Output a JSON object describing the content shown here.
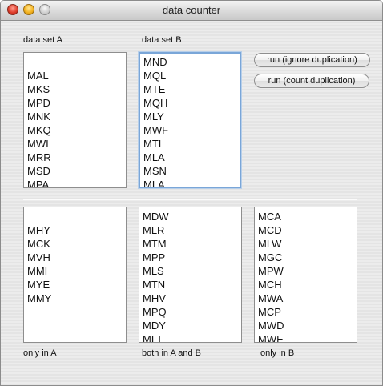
{
  "window": {
    "title": "data counter"
  },
  "inputs": {
    "set_a": {
      "label": "data set A",
      "lines": [
        "",
        "MAL",
        "MKS",
        "MPD",
        "MNK",
        "MKQ",
        "MWI",
        "MRR",
        "MSD",
        "MPA"
      ]
    },
    "set_b": {
      "label": "data set B",
      "lines": [
        "MND",
        "MQL",
        "MTE",
        "MQH",
        "MLY",
        "MWF",
        "MTI",
        "MLA",
        "MSN",
        "MLA"
      ]
    }
  },
  "buttons": {
    "ignore_dup": "run (ignore duplication)",
    "count_dup": "run (count duplication)"
  },
  "outputs": {
    "only_a": {
      "label": "only in A",
      "lines": [
        "",
        "MHY",
        "MCK",
        "MVH",
        "MMI",
        "MYE",
        "MMY"
      ]
    },
    "both": {
      "label": "both in A and B",
      "lines": [
        "MDW",
        "MLR",
        "MTM",
        "MPP",
        "MLS",
        "MTN",
        "MHV",
        "MPQ",
        "MDY",
        "MLT"
      ]
    },
    "only_b": {
      "label": "only in B",
      "lines": [
        "MCA",
        "MCD",
        "MLW",
        "MGC",
        "MPW",
        "MCH",
        "MWA",
        "MCP",
        "MWD",
        "MWE"
      ]
    }
  }
}
